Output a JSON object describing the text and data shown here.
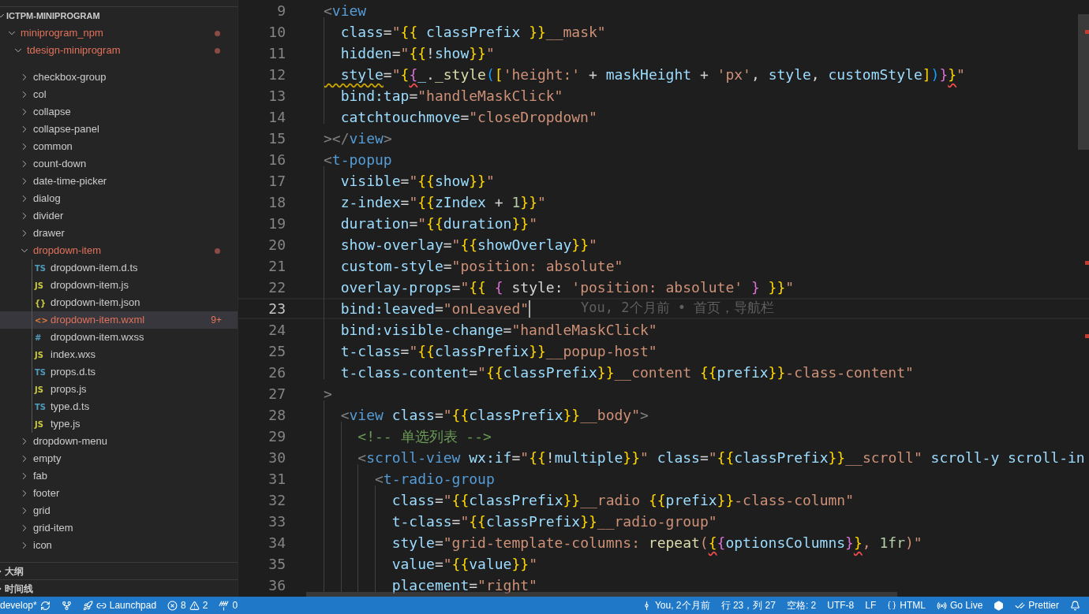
{
  "explorer": {
    "title": "ICTPM-MINIPROGRAM",
    "expanded": true,
    "items": [
      {
        "name": "miniprogram_npm",
        "kind": "folder",
        "expanded": true,
        "modified": true,
        "selected": false,
        "children": [
          {
            "name": "tdesign-miniprogram",
            "kind": "folder",
            "expanded": true,
            "modified": true,
            "selected": false,
            "children": [
              {
                "name": "checkbox-group",
                "kind": "folder",
                "expanded": false,
                "modified": false,
                "selected": false
              },
              {
                "name": "col",
                "kind": "folder",
                "expanded": false,
                "modified": false,
                "selected": false
              },
              {
                "name": "collapse",
                "kind": "folder",
                "expanded": false,
                "modified": false,
                "selected": false
              },
              {
                "name": "collapse-panel",
                "kind": "folder",
                "expanded": false,
                "modified": false,
                "selected": false
              },
              {
                "name": "common",
                "kind": "folder",
                "expanded": false,
                "modified": false,
                "selected": false
              },
              {
                "name": "count-down",
                "kind": "folder",
                "expanded": false,
                "modified": false,
                "selected": false
              },
              {
                "name": "date-time-picker",
                "kind": "folder",
                "expanded": false,
                "modified": false,
                "selected": false
              },
              {
                "name": "dialog",
                "kind": "folder",
                "expanded": false,
                "modified": false,
                "selected": false
              },
              {
                "name": "divider",
                "kind": "folder",
                "expanded": false,
                "modified": false,
                "selected": false
              },
              {
                "name": "drawer",
                "kind": "folder",
                "expanded": false,
                "modified": false,
                "selected": false
              },
              {
                "name": "dropdown-item",
                "kind": "folder",
                "expanded": true,
                "modified": true,
                "selected": false,
                "children": [
                  {
                    "name": "dropdown-item.d.ts",
                    "kind": "file",
                    "color": "#519aba",
                    "badge": "TS",
                    "modified": false,
                    "selected": false
                  },
                  {
                    "name": "dropdown-item.js",
                    "kind": "file",
                    "color": "#cbcb41",
                    "badge": "JS",
                    "modified": false,
                    "selected": false
                  },
                  {
                    "name": "dropdown-item.json",
                    "kind": "file",
                    "color": "#cbcb41",
                    "badge": "{}",
                    "modified": false,
                    "selected": false
                  },
                  {
                    "name": "dropdown-item.wxml",
                    "kind": "file",
                    "color": "#e37933",
                    "badge": "<>",
                    "modified": true,
                    "problems": "9+",
                    "selected": true
                  },
                  {
                    "name": "dropdown-item.wxss",
                    "kind": "file",
                    "color": "#519aba",
                    "badge": "#",
                    "modified": false,
                    "selected": false
                  },
                  {
                    "name": "index.wxs",
                    "kind": "file",
                    "color": "#cbcb41",
                    "badge": "JS",
                    "modified": false,
                    "selected": false
                  },
                  {
                    "name": "props.d.ts",
                    "kind": "file",
                    "color": "#519aba",
                    "badge": "TS",
                    "modified": false,
                    "selected": false
                  },
                  {
                    "name": "props.js",
                    "kind": "file",
                    "color": "#cbcb41",
                    "badge": "JS",
                    "modified": false,
                    "selected": false
                  },
                  {
                    "name": "type.d.ts",
                    "kind": "file",
                    "color": "#519aba",
                    "badge": "TS",
                    "modified": false,
                    "selected": false
                  },
                  {
                    "name": "type.js",
                    "kind": "file",
                    "color": "#cbcb41",
                    "badge": "JS",
                    "modified": false,
                    "selected": false
                  }
                ]
              },
              {
                "name": "dropdown-menu",
                "kind": "folder",
                "expanded": false,
                "modified": false,
                "selected": false
              },
              {
                "name": "empty",
                "kind": "folder",
                "expanded": false,
                "modified": false,
                "selected": false
              },
              {
                "name": "fab",
                "kind": "folder",
                "expanded": false,
                "modified": false,
                "selected": false
              },
              {
                "name": "footer",
                "kind": "folder",
                "expanded": false,
                "modified": false,
                "selected": false
              },
              {
                "name": "grid",
                "kind": "folder",
                "expanded": false,
                "modified": false,
                "selected": false
              },
              {
                "name": "grid-item",
                "kind": "folder",
                "expanded": false,
                "modified": false,
                "selected": false
              },
              {
                "name": "icon",
                "kind": "folder",
                "expanded": false,
                "modified": false,
                "selected": false
              }
            ]
          }
        ]
      }
    ]
  },
  "panels": [
    {
      "title": "大纲",
      "expanded": false
    },
    {
      "title": "时间线",
      "expanded": false
    }
  ],
  "editor": {
    "lines": [
      {
        "number": "9",
        "current": false,
        "tokens": [
          {
            "kind": "punct",
            "text": "<"
          },
          {
            "kind": "tag",
            "text": "view"
          }
        ]
      },
      {
        "number": "10",
        "current": false,
        "tokens": [
          {
            "kind": "attr",
            "text": "  class"
          },
          {
            "kind": "plain",
            "text": "="
          },
          {
            "kind": "str",
            "text": "\""
          },
          {
            "kind": "brace",
            "text": "{{"
          },
          {
            "kind": "attr",
            "text": " classPrefix "
          },
          {
            "kind": "brace",
            "text": "}}"
          },
          {
            "kind": "str",
            "text": "__mask\""
          }
        ]
      },
      {
        "number": "11",
        "current": false,
        "tokens": [
          {
            "kind": "attr",
            "text": "  hidden"
          },
          {
            "kind": "plain",
            "text": "="
          },
          {
            "kind": "str",
            "text": "\""
          },
          {
            "kind": "brace",
            "text": "{{"
          },
          {
            "kind": "plain",
            "text": "!"
          },
          {
            "kind": "attr",
            "text": "show"
          },
          {
            "kind": "brace",
            "text": "}}"
          },
          {
            "kind": "str",
            "text": "\""
          }
        ]
      },
      {
        "number": "12",
        "current": false,
        "tokens": [
          {
            "kind": "attr",
            "text": "  style",
            "warning": true
          },
          {
            "kind": "plain",
            "text": "="
          },
          {
            "kind": "str",
            "text": "\""
          },
          {
            "kind": "brace",
            "text": "{"
          },
          {
            "kind": "brace2",
            "text": "{",
            "error": true
          },
          {
            "kind": "attr",
            "text": "_"
          },
          {
            "kind": "plain",
            "text": "."
          },
          {
            "kind": "func",
            "text": "_style"
          },
          {
            "kind": "brace3",
            "text": "("
          },
          {
            "kind": "brace",
            "text": "["
          },
          {
            "kind": "str",
            "text": "'height:'"
          },
          {
            "kind": "plain",
            "text": " + "
          },
          {
            "kind": "attr",
            "text": "maskHeight"
          },
          {
            "kind": "plain",
            "text": " + "
          },
          {
            "kind": "str",
            "text": "'px'"
          },
          {
            "kind": "plain",
            "text": ", "
          },
          {
            "kind": "attr",
            "text": "style"
          },
          {
            "kind": "plain",
            "text": ", "
          },
          {
            "kind": "attr",
            "text": "customStyle"
          },
          {
            "kind": "brace",
            "text": "]"
          },
          {
            "kind": "brace3",
            "text": ")"
          },
          {
            "kind": "brace2",
            "text": "}"
          },
          {
            "kind": "brace",
            "text": "}",
            "error": true
          },
          {
            "kind": "str",
            "text": "\""
          }
        ]
      },
      {
        "number": "13",
        "current": false,
        "tokens": [
          {
            "kind": "attr",
            "text": "  bind:tap"
          },
          {
            "kind": "plain",
            "text": "="
          },
          {
            "kind": "str",
            "text": "\"handleMaskClick\""
          }
        ]
      },
      {
        "number": "14",
        "current": false,
        "tokens": [
          {
            "kind": "attr",
            "text": "  catchtouchmove"
          },
          {
            "kind": "plain",
            "text": "="
          },
          {
            "kind": "str",
            "text": "\"closeDropdown\""
          }
        ]
      },
      {
        "number": "15",
        "current": false,
        "tokens": [
          {
            "kind": "punct",
            "text": "></"
          },
          {
            "kind": "tag",
            "text": "view"
          },
          {
            "kind": "punct",
            "text": ">"
          }
        ]
      },
      {
        "number": "16",
        "current": false,
        "tokens": [
          {
            "kind": "punct",
            "text": "<"
          },
          {
            "kind": "tag",
            "text": "t-popup"
          }
        ]
      },
      {
        "number": "17",
        "current": false,
        "tokens": [
          {
            "kind": "attr",
            "text": "  visible"
          },
          {
            "kind": "plain",
            "text": "="
          },
          {
            "kind": "str",
            "text": "\""
          },
          {
            "kind": "brace",
            "text": "{{"
          },
          {
            "kind": "attr",
            "text": "show"
          },
          {
            "kind": "brace",
            "text": "}}"
          },
          {
            "kind": "str",
            "text": "\""
          }
        ]
      },
      {
        "number": "18",
        "current": false,
        "tokens": [
          {
            "kind": "attr",
            "text": "  z-index"
          },
          {
            "kind": "plain",
            "text": "="
          },
          {
            "kind": "str",
            "text": "\""
          },
          {
            "kind": "brace",
            "text": "{{"
          },
          {
            "kind": "attr",
            "text": "zIndex"
          },
          {
            "kind": "plain",
            "text": " + "
          },
          {
            "kind": "num",
            "text": "1"
          },
          {
            "kind": "brace",
            "text": "}}"
          },
          {
            "kind": "str",
            "text": "\""
          }
        ]
      },
      {
        "number": "19",
        "current": false,
        "tokens": [
          {
            "kind": "attr",
            "text": "  duration"
          },
          {
            "kind": "plain",
            "text": "="
          },
          {
            "kind": "str",
            "text": "\""
          },
          {
            "kind": "brace",
            "text": "{{"
          },
          {
            "kind": "attr",
            "text": "duration"
          },
          {
            "kind": "brace",
            "text": "}}"
          },
          {
            "kind": "str",
            "text": "\""
          }
        ]
      },
      {
        "number": "20",
        "current": false,
        "tokens": [
          {
            "kind": "attr",
            "text": "  show-overlay"
          },
          {
            "kind": "plain",
            "text": "="
          },
          {
            "kind": "str",
            "text": "\""
          },
          {
            "kind": "brace",
            "text": "{{"
          },
          {
            "kind": "attr",
            "text": "showOverlay"
          },
          {
            "kind": "brace",
            "text": "}}"
          },
          {
            "kind": "str",
            "text": "\""
          }
        ]
      },
      {
        "number": "21",
        "current": false,
        "tokens": [
          {
            "kind": "attr",
            "text": "  custom-style"
          },
          {
            "kind": "plain",
            "text": "="
          },
          {
            "kind": "str",
            "text": "\"position: absolute\""
          }
        ]
      },
      {
        "number": "22",
        "current": false,
        "tokens": [
          {
            "kind": "attr",
            "text": "  overlay-props"
          },
          {
            "kind": "plain",
            "text": "="
          },
          {
            "kind": "str",
            "text": "\""
          },
          {
            "kind": "brace",
            "text": "{{"
          },
          {
            "kind": "brace2",
            "text": " {"
          },
          {
            "kind": "plain",
            "text": " style: "
          },
          {
            "kind": "str",
            "text": "'position: absolute'"
          },
          {
            "kind": "brace2",
            "text": " }"
          },
          {
            "kind": "brace",
            "text": " }}"
          },
          {
            "kind": "str",
            "text": "\""
          }
        ]
      },
      {
        "number": "23",
        "current": true,
        "blame": "You, 2个月前 • 首页，导航栏",
        "tokens": [
          {
            "kind": "attr",
            "text": "  bind:leaved"
          },
          {
            "kind": "plain",
            "text": "="
          },
          {
            "kind": "str",
            "text": "\"onLeaved\""
          }
        ]
      },
      {
        "number": "24",
        "current": false,
        "tokens": [
          {
            "kind": "attr",
            "text": "  bind:visible-change"
          },
          {
            "kind": "plain",
            "text": "="
          },
          {
            "kind": "str",
            "text": "\"handleMaskClick\""
          }
        ]
      },
      {
        "number": "25",
        "current": false,
        "tokens": [
          {
            "kind": "attr",
            "text": "  t-class"
          },
          {
            "kind": "plain",
            "text": "="
          },
          {
            "kind": "str",
            "text": "\""
          },
          {
            "kind": "brace",
            "text": "{{"
          },
          {
            "kind": "attr",
            "text": "classPrefix"
          },
          {
            "kind": "brace",
            "text": "}}"
          },
          {
            "kind": "str",
            "text": "__popup-host\""
          }
        ]
      },
      {
        "number": "26",
        "current": false,
        "tokens": [
          {
            "kind": "attr",
            "text": "  t-class-content"
          },
          {
            "kind": "plain",
            "text": "="
          },
          {
            "kind": "str",
            "text": "\""
          },
          {
            "kind": "brace",
            "text": "{{"
          },
          {
            "kind": "attr",
            "text": "classPrefix"
          },
          {
            "kind": "brace",
            "text": "}}"
          },
          {
            "kind": "str",
            "text": "__content "
          },
          {
            "kind": "brace",
            "text": "{{"
          },
          {
            "kind": "attr",
            "text": "prefix"
          },
          {
            "kind": "brace",
            "text": "}}"
          },
          {
            "kind": "str",
            "text": "-class-content\""
          }
        ]
      },
      {
        "number": "27",
        "current": false,
        "tokens": [
          {
            "kind": "punct",
            "text": ">"
          }
        ]
      },
      {
        "number": "28",
        "current": false,
        "tokens": [
          {
            "kind": "punct",
            "text": "  <"
          },
          {
            "kind": "tag",
            "text": "view"
          },
          {
            "kind": "attr",
            "text": " class"
          },
          {
            "kind": "plain",
            "text": "="
          },
          {
            "kind": "str",
            "text": "\""
          },
          {
            "kind": "brace",
            "text": "{{"
          },
          {
            "kind": "attr",
            "text": "classPrefix"
          },
          {
            "kind": "brace",
            "text": "}}"
          },
          {
            "kind": "str",
            "text": "__body\""
          },
          {
            "kind": "punct",
            "text": ">"
          }
        ]
      },
      {
        "number": "29",
        "current": false,
        "tokens": [
          {
            "kind": "comment",
            "text": "    <!-- 单选列表 -->"
          }
        ]
      },
      {
        "number": "30",
        "current": false,
        "tokens": [
          {
            "kind": "punct",
            "text": "    <"
          },
          {
            "kind": "tag",
            "text": "scroll-view"
          },
          {
            "kind": "attr",
            "text": " wx:if"
          },
          {
            "kind": "plain",
            "text": "="
          },
          {
            "kind": "str",
            "text": "\""
          },
          {
            "kind": "brace",
            "text": "{{"
          },
          {
            "kind": "plain",
            "text": "!"
          },
          {
            "kind": "attr",
            "text": "multiple"
          },
          {
            "kind": "brace",
            "text": "}}"
          },
          {
            "kind": "str",
            "text": "\""
          },
          {
            "kind": "attr",
            "text": " class"
          },
          {
            "kind": "plain",
            "text": "="
          },
          {
            "kind": "str",
            "text": "\""
          },
          {
            "kind": "brace",
            "text": "{{"
          },
          {
            "kind": "attr",
            "text": "classPrefix"
          },
          {
            "kind": "brace",
            "text": "}}"
          },
          {
            "kind": "str",
            "text": "__scroll\""
          },
          {
            "kind": "attr",
            "text": " scroll-y scroll-in"
          }
        ]
      },
      {
        "number": "31",
        "current": false,
        "tokens": [
          {
            "kind": "punct",
            "text": "      <"
          },
          {
            "kind": "tag",
            "text": "t-radio-group"
          }
        ]
      },
      {
        "number": "32",
        "current": false,
        "tokens": [
          {
            "kind": "attr",
            "text": "        class"
          },
          {
            "kind": "plain",
            "text": "="
          },
          {
            "kind": "str",
            "text": "\""
          },
          {
            "kind": "brace",
            "text": "{{"
          },
          {
            "kind": "attr",
            "text": "classPrefix"
          },
          {
            "kind": "brace",
            "text": "}}"
          },
          {
            "kind": "str",
            "text": "__radio "
          },
          {
            "kind": "brace",
            "text": "{{"
          },
          {
            "kind": "attr",
            "text": "prefix"
          },
          {
            "kind": "brace",
            "text": "}}"
          },
          {
            "kind": "str",
            "text": "-class-column\""
          }
        ]
      },
      {
        "number": "33",
        "current": false,
        "tokens": [
          {
            "kind": "attr",
            "text": "        t-class"
          },
          {
            "kind": "plain",
            "text": "="
          },
          {
            "kind": "str",
            "text": "\""
          },
          {
            "kind": "brace",
            "text": "{{"
          },
          {
            "kind": "attr",
            "text": "classPrefix"
          },
          {
            "kind": "brace",
            "text": "}}"
          },
          {
            "kind": "str",
            "text": "__radio-group\""
          }
        ]
      },
      {
        "number": "34",
        "current": false,
        "tokens": [
          {
            "kind": "attr",
            "text": "        style"
          },
          {
            "kind": "plain",
            "text": "="
          },
          {
            "kind": "str",
            "text": "\"grid-template-columns: "
          },
          {
            "kind": "func",
            "text": "repeat"
          },
          {
            "kind": "str",
            "text": "("
          },
          {
            "kind": "brace",
            "text": "{",
            "error": true
          },
          {
            "kind": "brace2",
            "text": "{"
          },
          {
            "kind": "attr",
            "text": "optionsColumns"
          },
          {
            "kind": "brace2",
            "text": "}"
          },
          {
            "kind": "brace",
            "text": "}",
            "error": true
          },
          {
            "kind": "str",
            "text": ", "
          },
          {
            "kind": "num",
            "text": "1fr"
          },
          {
            "kind": "str",
            "text": ")\""
          }
        ]
      },
      {
        "number": "35",
        "current": false,
        "tokens": [
          {
            "kind": "attr",
            "text": "        value"
          },
          {
            "kind": "plain",
            "text": "="
          },
          {
            "kind": "str",
            "text": "\""
          },
          {
            "kind": "brace",
            "text": "{{"
          },
          {
            "kind": "attr",
            "text": "value"
          },
          {
            "kind": "brace",
            "text": "}}"
          },
          {
            "kind": "str",
            "text": "\""
          }
        ]
      },
      {
        "number": "36",
        "current": false,
        "tokens": [
          {
            "kind": "attr",
            "text": "        placement"
          },
          {
            "kind": "plain",
            "text": "="
          },
          {
            "kind": "str",
            "text": "\"right\""
          }
        ]
      }
    ]
  },
  "status_bar": {
    "branch": "develop*",
    "launchpad": "Launchpad",
    "errors": "8",
    "warnings": "2",
    "ports": "0",
    "blame": "You, 2个月前",
    "position": "行 23，列 27",
    "indent": "空格: 2",
    "encoding": "UTF-8",
    "eol": "LF",
    "language": "HTML",
    "go_live": "Go Live",
    "formatter": "Prettier"
  }
}
